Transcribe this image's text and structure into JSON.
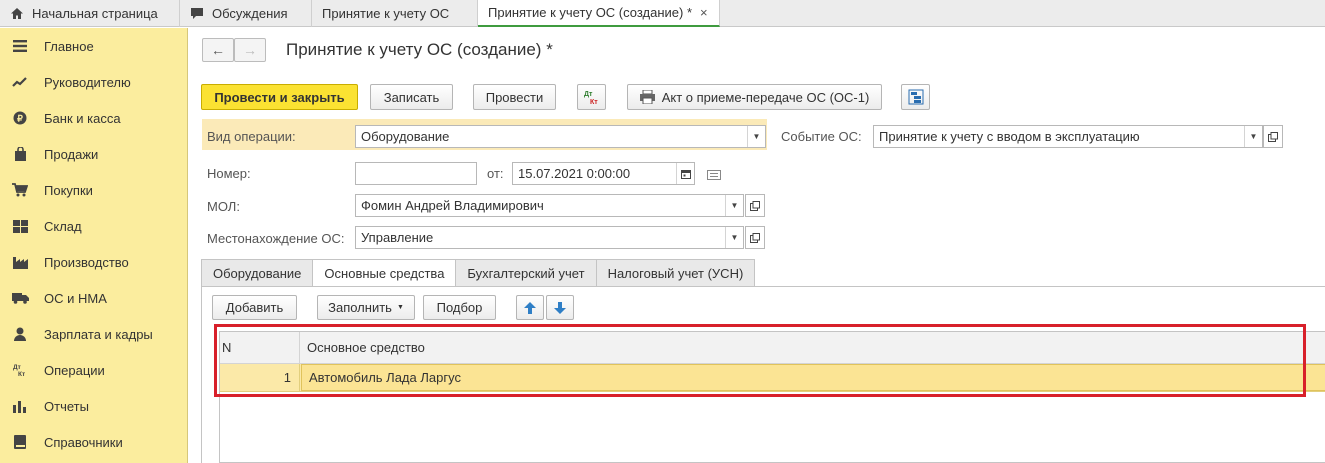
{
  "tabs_top": [
    {
      "label": "Начальная страница",
      "icon": "home-icon"
    },
    {
      "label": "Обсуждения",
      "icon": "chat-icon"
    },
    {
      "label": "Принятие к учету ОС"
    },
    {
      "label": "Принятие к учету ОС (создание) *",
      "active": true,
      "close": "×"
    }
  ],
  "sidebar": {
    "items": [
      {
        "label": "Главное",
        "icon": "menu-icon"
      },
      {
        "label": "Руководителю",
        "icon": "trend-icon"
      },
      {
        "label": "Банк и касса",
        "icon": "coin-icon"
      },
      {
        "label": "Продажи",
        "icon": "bag-icon"
      },
      {
        "label": "Покупки",
        "icon": "cart-icon"
      },
      {
        "label": "Склад",
        "icon": "warehouse-icon"
      },
      {
        "label": "Производство",
        "icon": "factory-icon"
      },
      {
        "label": "ОС и НМА",
        "icon": "truck-icon"
      },
      {
        "label": "Зарплата и кадры",
        "icon": "person-icon"
      },
      {
        "label": "Операции",
        "icon": "dt-kt-icon",
        "glyph": "Дт\nКт"
      },
      {
        "label": "Отчеты",
        "icon": "bar-chart-icon"
      },
      {
        "label": "Справочники",
        "icon": "book-icon"
      }
    ]
  },
  "header": {
    "title": "Принятие к учету ОС (создание) *",
    "back": "←",
    "forward": "→"
  },
  "toolbar": {
    "post_close": "Провести и закрыть",
    "save": "Записать",
    "post": "Провести",
    "dt_kt_top": "Дт",
    "dt_kt_bottom": "Кт",
    "act": "Акт о приеме-передаче ОС (ОС-1)"
  },
  "form": {
    "op_type_label": "Вид операции:",
    "op_type_value": "Оборудование",
    "event_label": "Событие ОС:",
    "event_value": "Принятие к учету с вводом в эксплуатацию",
    "number_label": "Номер:",
    "number_value": "",
    "date_label": "от:",
    "date_value": "15.07.2021  0:00:00",
    "mol_label": "МОЛ:",
    "mol_value": "Фомин Андрей Владимирович",
    "location_label": "Местонахождение ОС:",
    "location_value": "Управление"
  },
  "doc_tabs": [
    {
      "label": "Оборудование"
    },
    {
      "label": "Основные средства",
      "active": true
    },
    {
      "label": "Бухгалтерский учет"
    },
    {
      "label": "Налоговый учет (УСН)"
    }
  ],
  "table_toolbar": {
    "add": "Добавить",
    "fill": "Заполнить",
    "pick": "Подбор"
  },
  "table": {
    "columns": [
      "N",
      "Основное средство"
    ],
    "rows": [
      {
        "n": "1",
        "asset": "Автомобиль Лада Ларгус"
      }
    ]
  },
  "colors": {
    "sidebar_bg": "#fbed9e",
    "primary_button": "#fbe232",
    "highlight_row": "#fbe9a8",
    "red_frame": "#d8202a",
    "active_tab_line": "#3f9b3f"
  }
}
